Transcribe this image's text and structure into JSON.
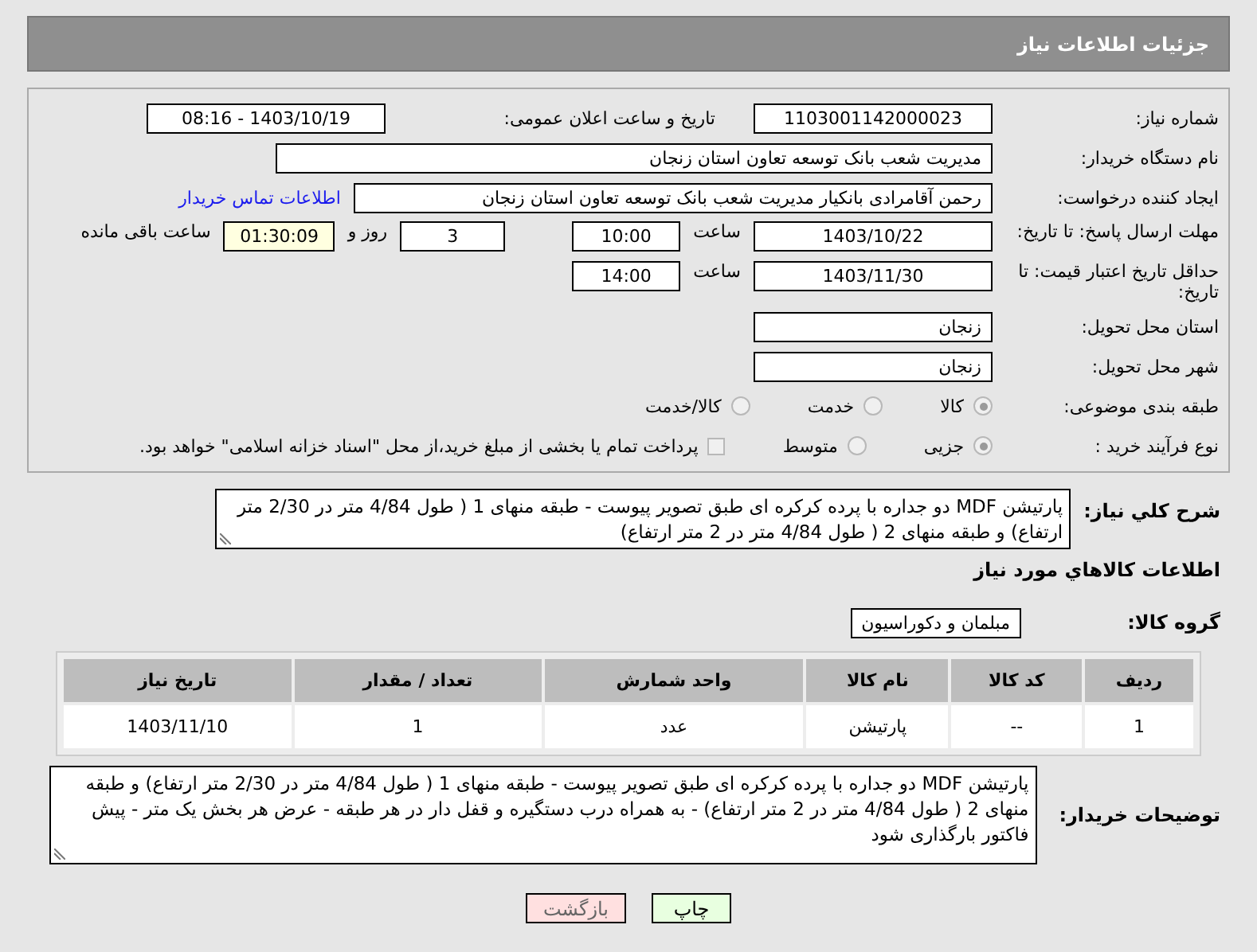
{
  "header": {
    "title": "جزئیات اطلاعات نیاز"
  },
  "need_number": {
    "label": "شماره نیاز:",
    "value": "1103001142000023"
  },
  "announce": {
    "label": "تاریخ و ساعت اعلان عمومی:",
    "value": "1403/10/19 - 08:16"
  },
  "buyer_org": {
    "label": "نام دستگاه خریدار:",
    "value": "مدیریت شعب بانک توسعه تعاون استان زنجان"
  },
  "requester": {
    "label": "ایجاد کننده درخواست:",
    "value": "رحمن آقامرادی بانکیار مدیریت شعب بانک توسعه تعاون استان زنجان",
    "link": "اطلاعات تماس خریدار"
  },
  "reply_deadline": {
    "label": "مهلت ارسال پاسخ: تا تاریخ:",
    "date": "1403/10/22",
    "time_label": "ساعت",
    "time": "10:00",
    "days": "3",
    "days_label": "روز و",
    "remaining": "01:30:09",
    "remaining_label": "ساعت باقی مانده"
  },
  "price_validity": {
    "label": "حداقل تاریخ اعتبار قیمت: تا تاریخ:",
    "date": "1403/11/30",
    "time_label": "ساعت",
    "time": "14:00"
  },
  "province": {
    "label": "استان محل تحویل:",
    "value": "زنجان"
  },
  "city": {
    "label": "شهر محل تحویل:",
    "value": "زنجان"
  },
  "category": {
    "label": "طبقه بندی موضوعی:",
    "options": [
      {
        "label": "کالا",
        "selected": true
      },
      {
        "label": "خدمت",
        "selected": false
      },
      {
        "label": "کالا/خدمت",
        "selected": false
      }
    ]
  },
  "process": {
    "label": "نوع فرآیند خرید :",
    "options": [
      {
        "label": "جزیی",
        "selected": true
      },
      {
        "label": "متوسط",
        "selected": false
      }
    ],
    "payment": {
      "label": "پرداخت تمام یا بخشی از مبلغ خرید،از محل \"اسناد خزانه اسلامی\" خواهد بود.",
      "checked": false
    }
  },
  "summary": {
    "label": "شرح کلي نياز:",
    "value": "پارتیشن MDF دو جداره با پرده کرکره ای طبق تصویر پیوست - طبقه منهای 1 ( طول 4/84 متر در 2/30 متر ارتفاع) و طبقه منهای 2 ( طول 4/84 متر در 2 متر ارتفاع)"
  },
  "goods_title": "اطلاعات کالاهاي مورد نياز",
  "goods_group": {
    "label": "گروه کالا:",
    "value": "مبلمان و دکوراسیون"
  },
  "table": {
    "columns": [
      "ردیف",
      "کد کالا",
      "نام کالا",
      "واحد شمارش",
      "تعداد / مقدار",
      "تاریخ نیاز"
    ],
    "rows": [
      [
        "1",
        "--",
        "پارتیشن",
        "عدد",
        "1",
        "1403/11/10"
      ]
    ]
  },
  "buyer_notes": {
    "label": "توضیحات خریدار:",
    "value": "پارتیشن MDF دو جداره با پرده کرکره ای طبق تصویر پیوست - طبقه منهای 1 ( طول 4/84 متر در 2/30 متر ارتفاع) و طبقه منهای 2 ( طول 4/84 متر در 2 متر ارتفاع) - به همراه درب دستگیره و قفل دار در هر طبقه - عرض هر بخش یک متر - پیش فاکتور بارگذاری شود"
  },
  "buttons": [
    {
      "label": "چاپ",
      "kind": "print"
    },
    {
      "label": "بازگشت",
      "kind": "back"
    }
  ]
}
